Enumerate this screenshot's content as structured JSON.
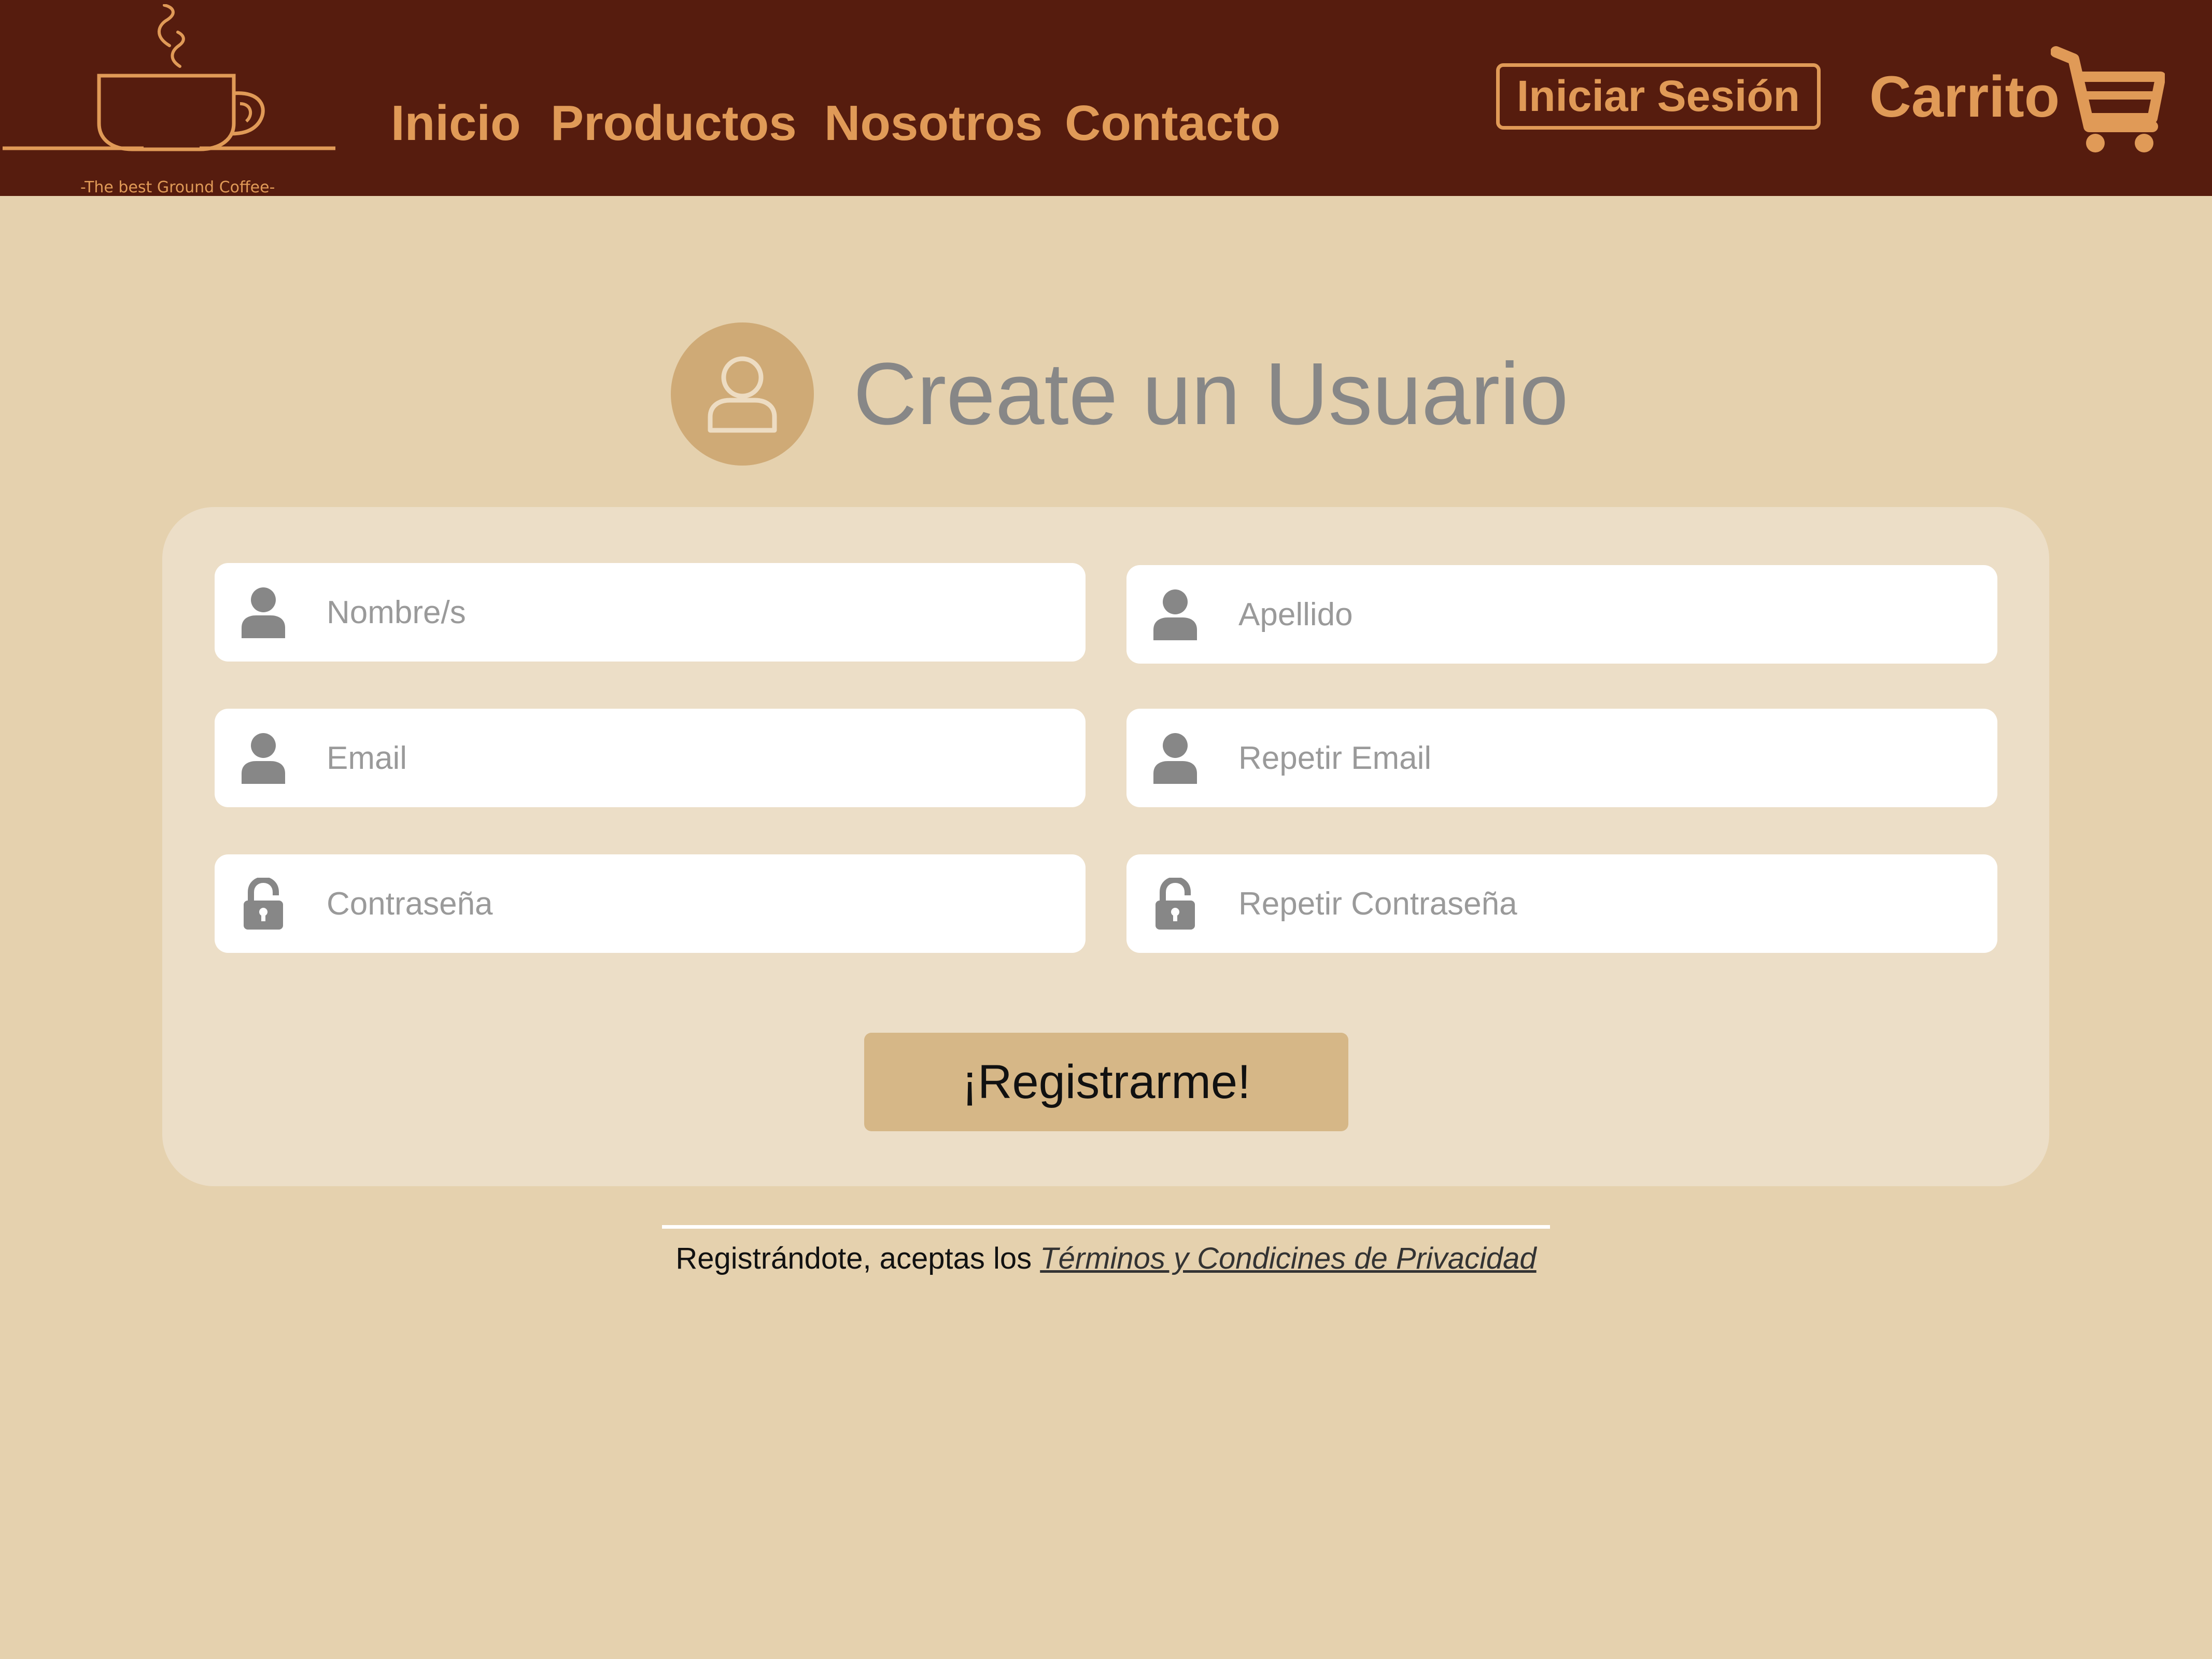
{
  "brand": {
    "tagline": "-The best Ground Coffee-"
  },
  "nav": [
    {
      "label": "Inicio"
    },
    {
      "label": "Productos"
    },
    {
      "label": "Nosotros"
    },
    {
      "label": "Contacto"
    }
  ],
  "header": {
    "login_label": "Iniciar Sesión",
    "cart_label": "Carrito"
  },
  "main": {
    "title": "Create un Usuario",
    "fields": {
      "first_name": {
        "placeholder": "Nombre/s",
        "icon": "user-icon"
      },
      "last_name": {
        "placeholder": "Apellido",
        "icon": "user-icon"
      },
      "email": {
        "placeholder": "Email",
        "icon": "user-icon"
      },
      "repeat_email": {
        "placeholder": "Repetir Email",
        "icon": "user-icon"
      },
      "password": {
        "placeholder": "Contraseña",
        "icon": "lock-icon"
      },
      "repeat_password": {
        "placeholder": "Repetir Contraseña",
        "icon": "lock-icon"
      }
    },
    "submit_label": "¡Registrarme!",
    "legal_prefix": "Registrándote, aceptas los ",
    "legal_link": "Términos y Condicines de Privacidad"
  },
  "colors": {
    "header_bg": "#561c0e",
    "accent": "#e09a57",
    "page_bg": "#e5d1ae",
    "card_bg": "#ecdec7",
    "button_bg": "#d6b787",
    "avatar_bg": "#cfaa76",
    "icon_gray": "#878787"
  }
}
